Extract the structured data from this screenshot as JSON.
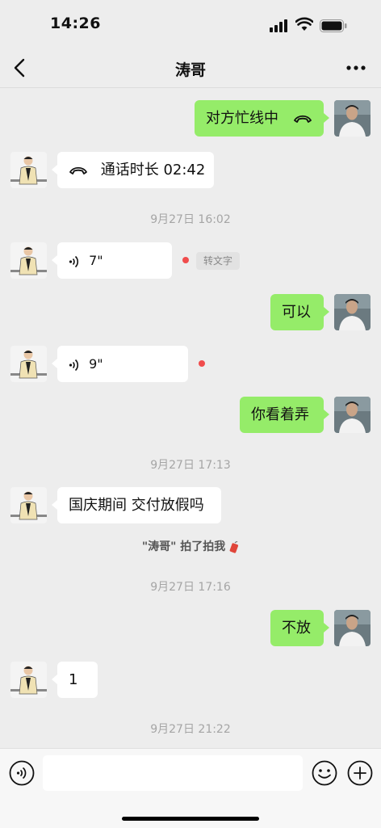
{
  "status_bar": {
    "time": "14:26"
  },
  "nav": {
    "title": "涛哥"
  },
  "messages": {
    "m1": {
      "text": "对方忙线中"
    },
    "m2": {
      "text": "通话时长 02:42"
    },
    "ts1": "9月27日 16:02",
    "m3": {
      "duration": "7\"",
      "transcribe": "转文字"
    },
    "m4": {
      "text": "可以"
    },
    "m5": {
      "duration": "9\""
    },
    "m6": {
      "text": "你看着弄"
    },
    "ts2": "9月27日 17:13",
    "m7": {
      "text": "国庆期间 交付放假吗"
    },
    "pat": "\"涛哥\" 拍了拍我",
    "ts3": "9月27日 17:16",
    "m8": {
      "text": "不放"
    },
    "m9": {
      "text": "1"
    },
    "ts4": "9月27日 21:22"
  },
  "colors": {
    "sent_bubble": "#95ec69",
    "received_bubble": "#ffffff",
    "background": "#ededed",
    "unread_dot": "#f04c4c"
  }
}
